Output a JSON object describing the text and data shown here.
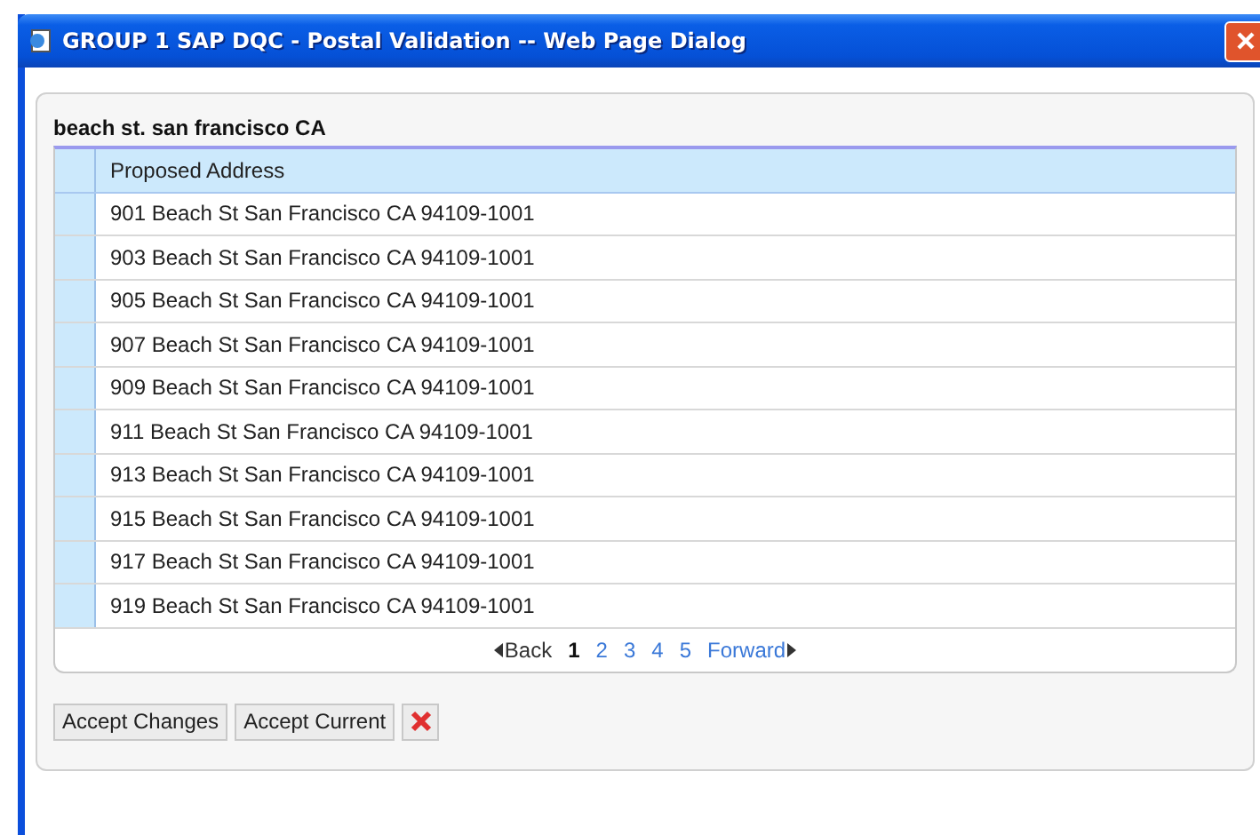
{
  "window": {
    "title": "GROUP 1 SAP DQC - Postal Validation -- Web Page Dialog"
  },
  "query": "beach st. san francisco CA",
  "table": {
    "columns": [
      "Proposed Address"
    ],
    "rows": [
      {
        "address": "901 Beach St San Francisco CA 94109-1001",
        "selected": false
      },
      {
        "address": "903 Beach St San Francisco CA 94109-1001",
        "selected": false
      },
      {
        "address": "905 Beach St San Francisco CA 94109-1001",
        "selected": false
      },
      {
        "address": "907 Beach St San Francisco CA 94109-1001",
        "selected": false
      },
      {
        "address": "909 Beach St San Francisco CA 94109-1001",
        "selected": false
      },
      {
        "address": "911 Beach St San Francisco CA 94109-1001",
        "selected": false
      },
      {
        "address": "913 Beach St San Francisco CA 94109-1001",
        "selected": false
      },
      {
        "address": "915 Beach St San Francisco CA 94109-1001",
        "selected": false
      },
      {
        "address": "917 Beach St San Francisco CA 94109-1001",
        "selected": false
      },
      {
        "address": "919 Beach St San Francisco CA 94109-1001",
        "selected": false
      }
    ]
  },
  "pager": {
    "back": "Back",
    "forward": "Forward",
    "pages": [
      {
        "label": "1",
        "selected": true
      },
      {
        "label": "2",
        "selected": false
      },
      {
        "label": "3",
        "selected": false
      },
      {
        "label": "4",
        "selected": false
      },
      {
        "label": "5",
        "selected": false
      }
    ]
  },
  "buttons": [
    "Accept Changes",
    "Accept Current"
  ]
}
